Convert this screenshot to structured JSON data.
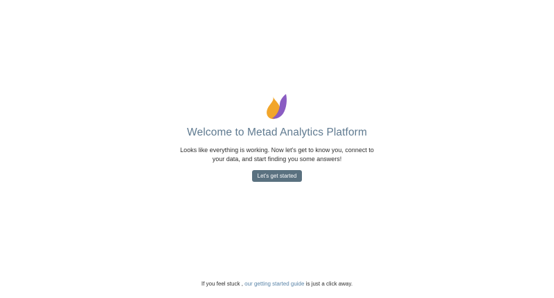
{
  "welcome": {
    "logo_icon": "metad-flame-logo",
    "logo_colors": {
      "orange": "#f2a62b",
      "purple": "#8a5cc2"
    },
    "title": "Welcome to Metad Analytics Platform",
    "subtitle": "Looks like everything is working. Now let's get to know you, connect to your data, and start finding you some answers!",
    "cta_label": "Let's get started",
    "cta_color": "#5a7180"
  },
  "footer": {
    "prefix": "If you feel stuck ,",
    "link_text": "our getting started guide",
    "suffix": "is just a click away.",
    "link_color": "#5a84a8"
  }
}
